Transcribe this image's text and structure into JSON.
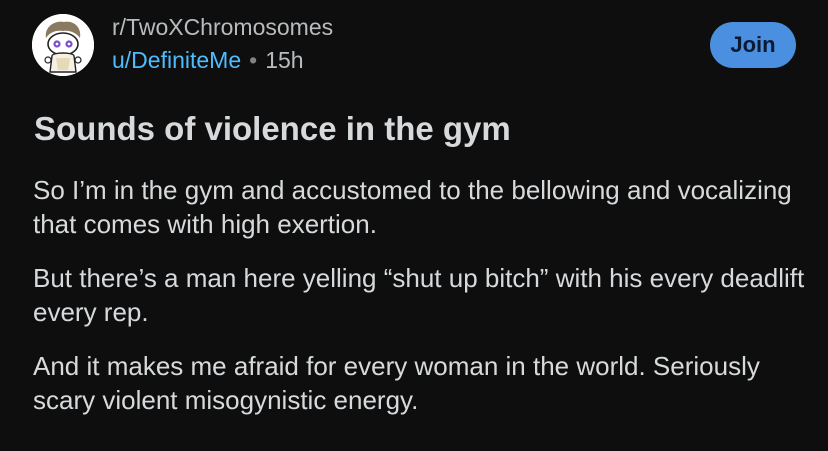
{
  "post": {
    "subreddit": "r/TwoXChromosomes",
    "author": "u/DefiniteMe",
    "separator": "•",
    "time": "15h",
    "join_label": "Join",
    "title": "Sounds of violence in the gym",
    "paragraphs": [
      "So I’m in the gym and accustomed to the bellowing and vocalizing that comes with high exertion.",
      "But there’s a man here yelling “shut up bitch” with his every deadlift every rep.",
      "And it makes me afraid for every woman in the world. Seriously scary violent misogynistic energy."
    ]
  },
  "colors": {
    "background": "#0e0e0e",
    "username": "#4fbcff",
    "join_button": "#4a8fe0"
  },
  "icons": {
    "avatar": "snoo-avatar-icon"
  }
}
